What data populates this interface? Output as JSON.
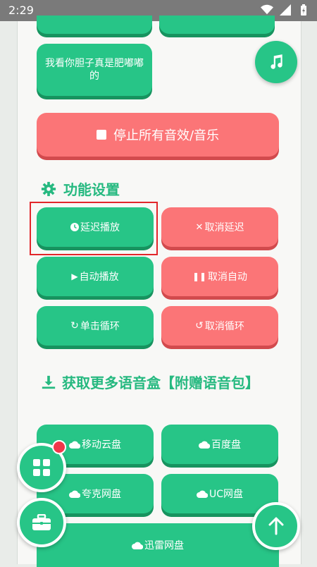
{
  "status": {
    "time": "2:29"
  },
  "sounds": {
    "item_label": "我看你胆子真是肥嘟嘟的"
  },
  "stop_button": {
    "label": "停止所有音效/音乐"
  },
  "settings": {
    "title": "功能设置",
    "buttons": [
      {
        "label": "延迟播放",
        "icon": "clock-icon"
      },
      {
        "label": "取消延迟",
        "icon": "x-icon"
      },
      {
        "label": "自动播放",
        "icon": "play-icon"
      },
      {
        "label": "取消自动",
        "icon": "pause-icon"
      },
      {
        "label": "单击循环",
        "icon": "redo-icon"
      },
      {
        "label": "取消循环",
        "icon": "undo-icon"
      }
    ]
  },
  "download": {
    "title": "获取更多语音盒【附赠语音包】",
    "buttons": [
      {
        "label": "移动云盘",
        "icon": "cloud-icon"
      },
      {
        "label": "百度盘",
        "icon": "cloud-icon"
      },
      {
        "label": "夸克网盘",
        "icon": "cloud-icon"
      },
      {
        "label": "UC网盘",
        "icon": "cloud-icon"
      },
      {
        "label": "迅雷网盘",
        "icon": "cloud-icon"
      }
    ]
  },
  "colors": {
    "green": "#27c587",
    "red": "#fb7577",
    "title_green": "#26b980"
  }
}
